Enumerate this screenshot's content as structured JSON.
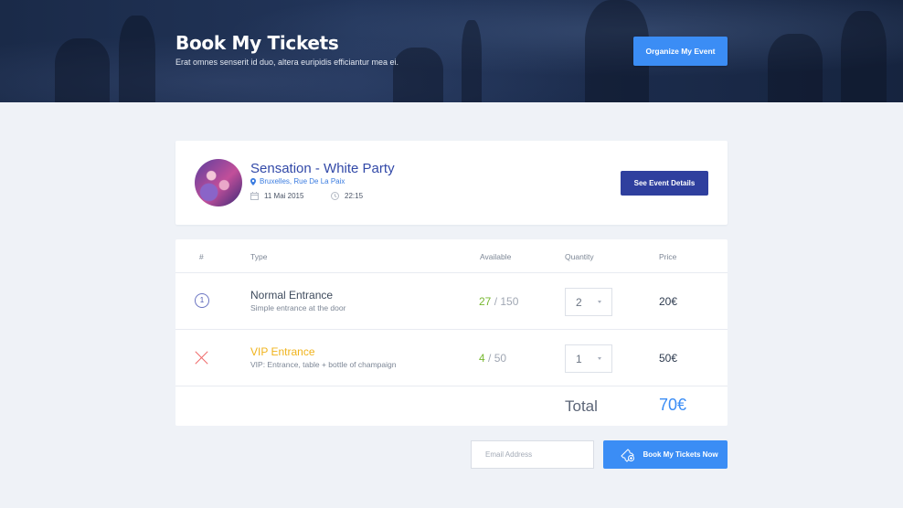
{
  "header": {
    "title": "Book My Tickets",
    "subtitle": "Erat omnes senserit id duo, altera euripidis efficiantur mea ei.",
    "organize_label": "Organize My Event"
  },
  "event": {
    "title": "Sensation - White Party",
    "location": "Bruxelles, Rue De La Paix",
    "date": "11 Mai 2015",
    "time": "22:15",
    "details_label": "See Event Details"
  },
  "table": {
    "headers": [
      "#",
      "Type",
      "Available",
      "Quantity",
      "Price"
    ],
    "rows": [
      {
        "num": "1",
        "name": "Normal Entrance",
        "desc": "Simple entrance at the door",
        "available": "27",
        "capacity": "/ 150",
        "quantity": "2",
        "price": "20€",
        "status": "selected"
      },
      {
        "num": "",
        "name": "VIP Entrance",
        "desc": "VIP: Entrance, table + bottle of champaign",
        "available": "4",
        "capacity": "/ 50",
        "quantity": "1",
        "price": "50€",
        "status": "removed"
      }
    ],
    "total_label": "Total",
    "total_value": "70€"
  },
  "booking": {
    "email_placeholder": "Email Address",
    "book_label": "Book My Tickets Now"
  },
  "colors": {
    "accent": "#3b8df5",
    "navy": "#2f3f9e",
    "available": "#77b830",
    "vip": "#f0b31c",
    "remove": "#ef6b6b"
  }
}
